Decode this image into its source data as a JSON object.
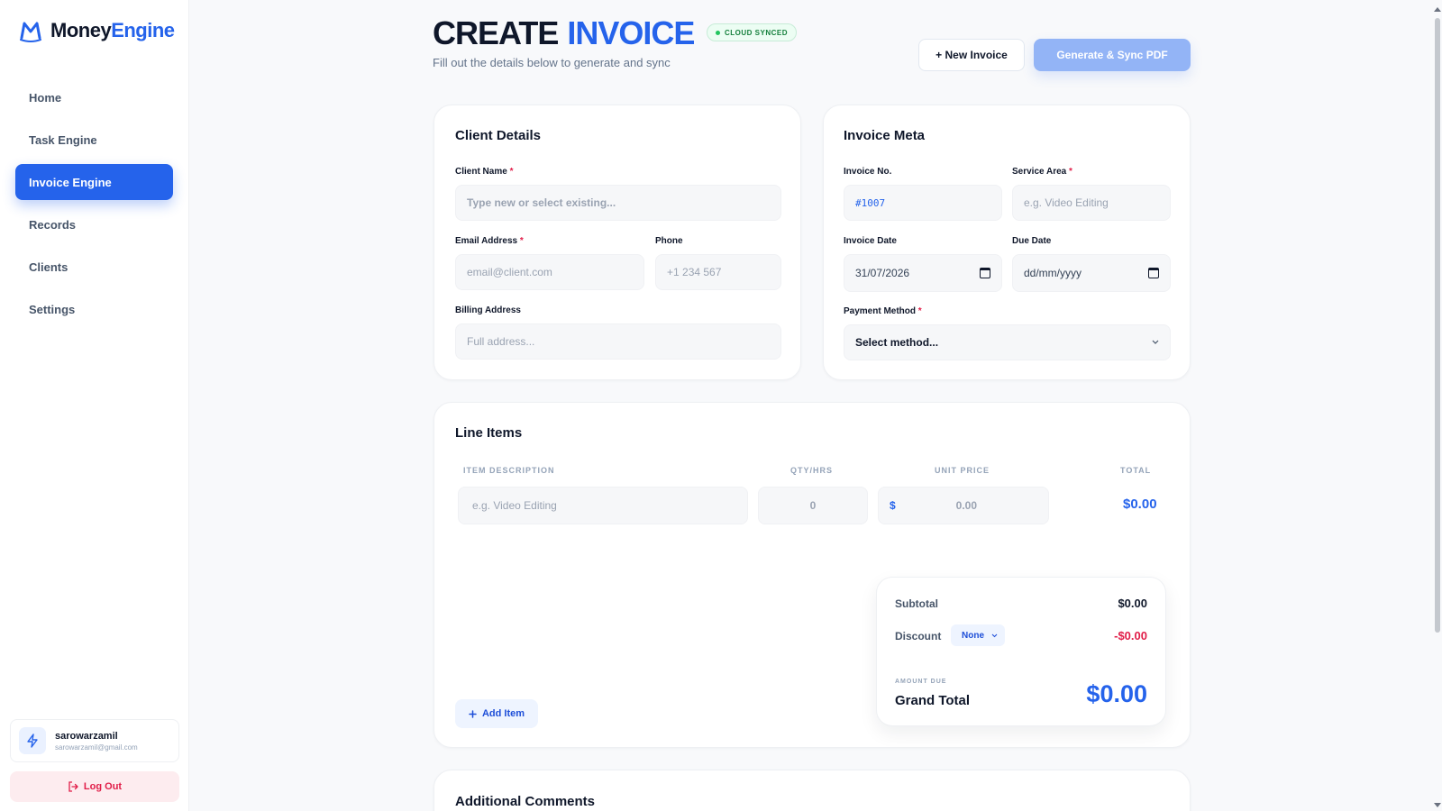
{
  "app": {
    "name_part1": "Money",
    "name_part2": "Engine"
  },
  "colors": {
    "accent": "#2563eb",
    "danger": "#e11d48",
    "success": "#22c55e"
  },
  "sidebar": {
    "items": [
      {
        "label": "Home",
        "active": false
      },
      {
        "label": "Task Engine",
        "active": false
      },
      {
        "label": "Invoice Engine",
        "active": true
      },
      {
        "label": "Records",
        "active": false
      },
      {
        "label": "Clients",
        "active": false
      },
      {
        "label": "Settings",
        "active": false
      }
    ],
    "user": {
      "name": "sarowarzamil",
      "email": "sarowarzamil@gmail.com",
      "icon": "bolt-icon"
    },
    "logout_label": "Log Out",
    "logout_icon": "logout-icon"
  },
  "header": {
    "title_part1": "CREATE",
    "title_part2": "INVOICE",
    "badge": "CLOUD SYNCED",
    "subtitle": "Fill out the details below to generate and sync",
    "new_invoice_label": "+ New Invoice",
    "generate_label": "Generate & Sync PDF"
  },
  "client_details": {
    "title": "Client Details",
    "client_name_label": "Client Name",
    "client_name_placeholder": "Type new or select existing...",
    "email_label": "Email Address",
    "email_placeholder": "email@client.com",
    "phone_label": "Phone",
    "phone_placeholder": "+1 234 567",
    "billing_label": "Billing Address",
    "billing_placeholder": "Full address..."
  },
  "invoice_meta": {
    "title": "Invoice Meta",
    "invoice_no_label": "Invoice No.",
    "invoice_no_value": "#1007",
    "service_area_label": "Service Area",
    "service_area_placeholder": "e.g. Video Editing",
    "invoice_date_label": "Invoice Date",
    "invoice_date_value": "31/07/2026",
    "due_date_label": "Due Date",
    "due_date_value": "dd/mm/yyyy",
    "payment_method_label": "Payment Method",
    "payment_method_value": "Select method..."
  },
  "line_items": {
    "title": "Line Items",
    "headers": {
      "description": "ITEM DESCRIPTION",
      "qty": "QTY/HRS",
      "unit_price": "UNIT PRICE",
      "total": "TOTAL"
    },
    "rows": [
      {
        "description_placeholder": "e.g. Video Editing",
        "qty": "0",
        "currency": "$",
        "unit_price": "0.00",
        "total": "$0.00"
      }
    ],
    "add_item_label": "Add Item"
  },
  "summary": {
    "subtotal_label": "Subtotal",
    "subtotal_value": "$0.00",
    "discount_label": "Discount",
    "discount_option": "None",
    "discount_value": "-$0.00",
    "amount_due_label": "AMOUNT DUE",
    "grand_total_label": "Grand Total",
    "grand_total_value": "$0.00"
  },
  "comments": {
    "title": "Additional Comments"
  }
}
